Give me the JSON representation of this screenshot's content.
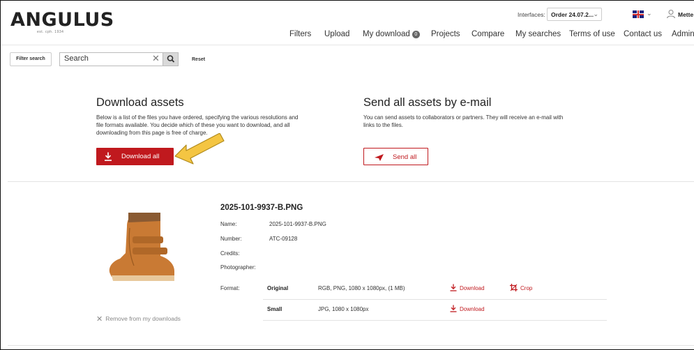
{
  "brand": {
    "name": "ANGULUS",
    "tagline": "est. cph. 1934"
  },
  "header": {
    "interfaces_label": "Interfaces:",
    "interface_value": "Order 24.07.2...",
    "user_name": "Mette"
  },
  "nav": {
    "filters": "Filters",
    "upload": "Upload",
    "my_download": "My download",
    "my_download_count": "0",
    "projects": "Projects",
    "compare": "Compare",
    "my_searches": "My searches",
    "terms": "Terms of use",
    "contact": "Contact us",
    "admin": "Admin"
  },
  "search": {
    "filter_label": "Filter search",
    "value": "Search",
    "reset_label": "Reset"
  },
  "download_section": {
    "title": "Download assets",
    "description": "Below is a list of the files you have ordered, specifying the various resolutions and file formats available. You decide which of these you want to download, and all downloading from this page is free of charge.",
    "button_label": "Download all"
  },
  "email_section": {
    "title": "Send all assets by e-mail",
    "description": "You can send assets to collaborators or partners. They will receive an e-mail with links to the files.",
    "button_label": "Send all"
  },
  "asset": {
    "title": "2025-101-9937-B.PNG",
    "name_label": "Name:",
    "name_value": "2025-101-9937-B.PNG",
    "number_label": "Number:",
    "number_value": "ATC-09128",
    "credits_label": "Credits:",
    "photographer_label": "Photographer:",
    "format_label": "Format:",
    "formats": [
      {
        "name": "Original",
        "desc": "RGB, PNG, 1080 x 1080px, (1 MB)",
        "download": "Download",
        "crop": "Crop"
      },
      {
        "name": "Small",
        "desc": "JPG, 1080 x 1080px",
        "download": "Download"
      }
    ],
    "remove_label": "Remove from my downloads"
  },
  "colors": {
    "accent": "#c0191e",
    "highlight_arrow": "#f4c542"
  }
}
